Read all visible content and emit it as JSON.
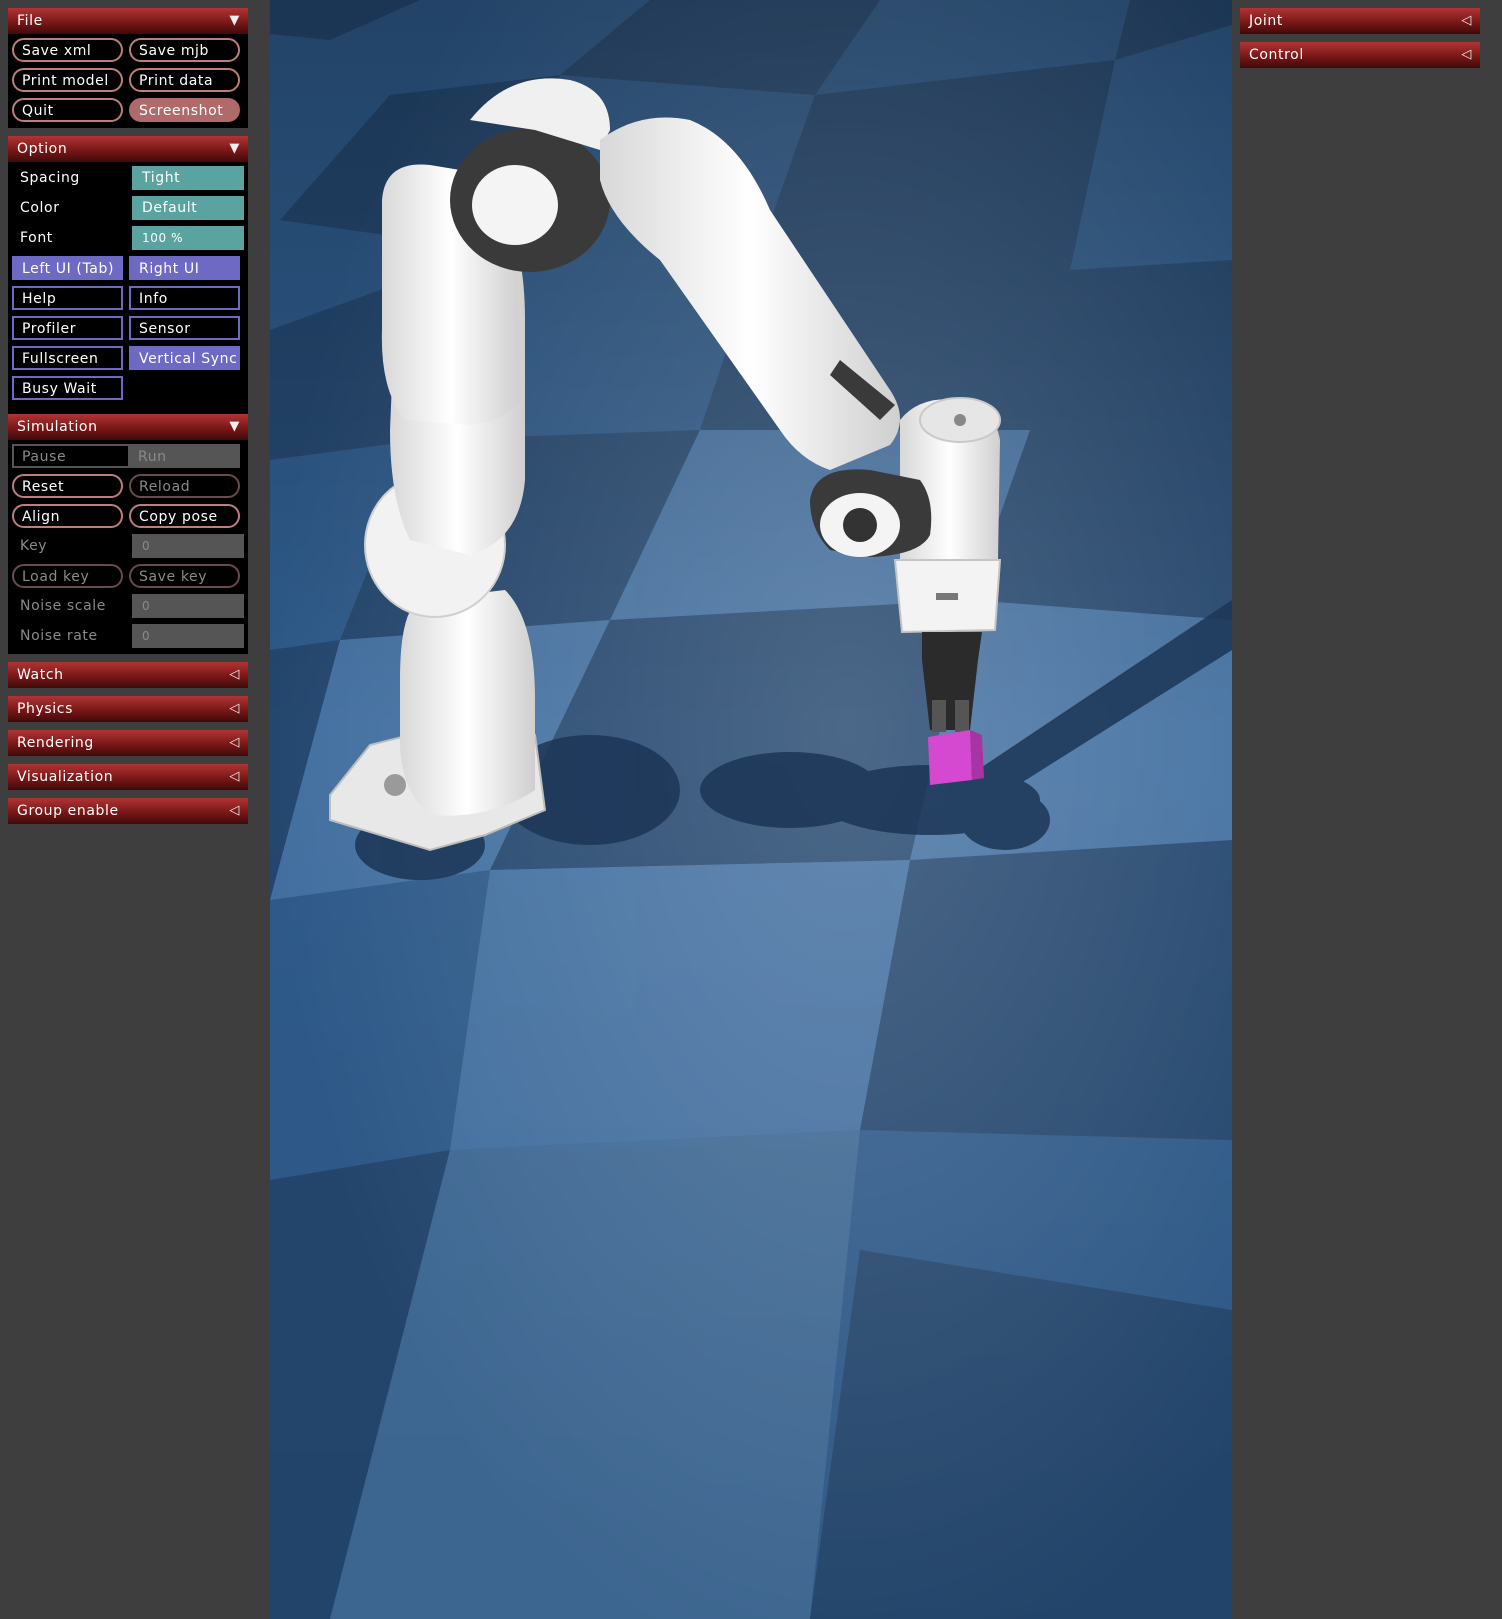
{
  "left_panel": {
    "file": {
      "title": "File",
      "buttons": {
        "save_xml": "Save xml",
        "save_mjb": "Save mjb",
        "print_model": "Print model",
        "print_data": "Print data",
        "quit": "Quit",
        "screenshot": "Screenshot"
      }
    },
    "option": {
      "title": "Option",
      "spacing_label": "Spacing",
      "spacing_value": "Tight",
      "color_label": "Color",
      "color_value": "Default",
      "font_label": "Font",
      "font_value": "100 %",
      "toggles": {
        "left_ui": "Left UI (Tab)",
        "right_ui": "Right UI",
        "help": "Help",
        "info": "Info",
        "profiler": "Profiler",
        "sensor": "Sensor",
        "fullscreen": "Fullscreen",
        "vertical_sync": "Vertical Sync",
        "busy_wait": "Busy Wait"
      }
    },
    "simulation": {
      "title": "Simulation",
      "pause": "Pause",
      "run": "Run",
      "reset": "Reset",
      "reload": "Reload",
      "align": "Align",
      "copy_pose": "Copy pose",
      "key_label": "Key",
      "key_value": "0",
      "load_key": "Load key",
      "save_key": "Save key",
      "noise_scale_label": "Noise scale",
      "noise_scale_value": "0",
      "noise_rate_label": "Noise rate",
      "noise_rate_value": "0"
    },
    "collapsed_sections": [
      "Watch",
      "Physics",
      "Rendering",
      "Visualization",
      "Group enable"
    ]
  },
  "right_panel": {
    "sections": [
      "Joint",
      "Control"
    ]
  },
  "icons": {
    "expanded": "triangle-down-icon",
    "collapsed": "triangle-left-icon"
  },
  "colors": {
    "panel_bg": "#3e3e3e",
    "header_red": "#8a1c1c",
    "button_border_red": "#bf7d7d",
    "toggle_purple": "#6e69c3",
    "select_teal": "#5aa3a0",
    "target_block_magenta": "#d548d0"
  }
}
